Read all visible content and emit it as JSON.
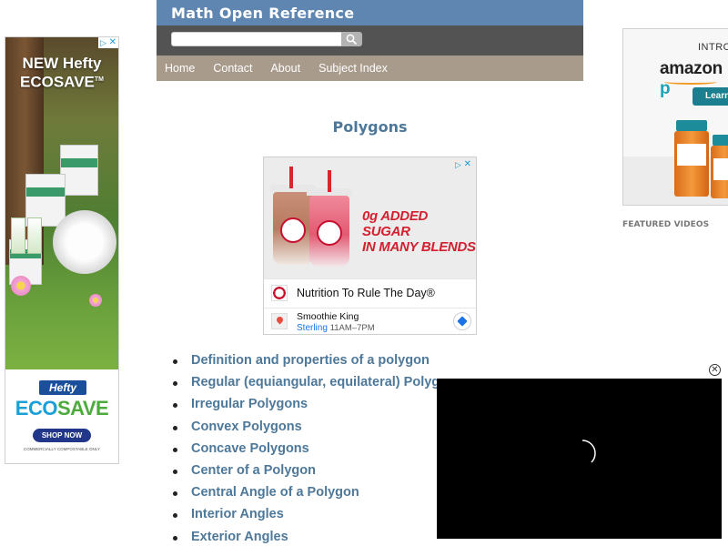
{
  "header": {
    "site_title": "Math Open Reference",
    "search": {
      "value": "",
      "placeholder": ""
    },
    "nav": [
      "Home",
      "Contact",
      "About",
      "Subject Index"
    ]
  },
  "page": {
    "title": "Polygons"
  },
  "topics": [
    "Definition and properties of a polygon",
    "Regular (equiangular, equilateral) Polygons",
    "Irregular Polygons",
    "Convex Polygons",
    "Concave Polygons",
    "Center of a Polygon",
    "Central Angle of a Polygon",
    "Interior Angles",
    "Exterior Angles"
  ],
  "left_ad": {
    "headline_line1": "NEW Hefty",
    "headline_line2": "ECOSAVE",
    "trademark": "TM",
    "brand": "Hefty",
    "eco": "ECO",
    "save": "SAVE",
    "cta": "SHOP NOW",
    "fine_print": "COMMERCIALLY COMPOSTABLE ONLY",
    "colors": {
      "blue": "#1a9fd8",
      "green": "#4dab3e",
      "navy": "#22368a"
    }
  },
  "middle_ad": {
    "headline_line1": "0g ADDED SUGAR",
    "headline_line2": "IN MANY BLENDS",
    "tagline": "Nutrition To Rule The Day®",
    "business_name": "Smoothie King",
    "location": "Sterling",
    "hours": "11AM–7PM",
    "brand_color": "#c8102e"
  },
  "right_ad": {
    "intro": "INTROD",
    "brand_amazon": "amazon",
    "brand_p": "p",
    "button": "Learn"
  },
  "featured_videos": "FEATURED VIDEOS",
  "video": {
    "close_symbol": "✕"
  },
  "ad_choices": {
    "triangle": "▷",
    "close": "✕"
  },
  "colors": {
    "title_bar": "#5f86b1",
    "search_bar": "#535353",
    "nav_bar": "#a89b8c",
    "link": "#4e7899"
  }
}
